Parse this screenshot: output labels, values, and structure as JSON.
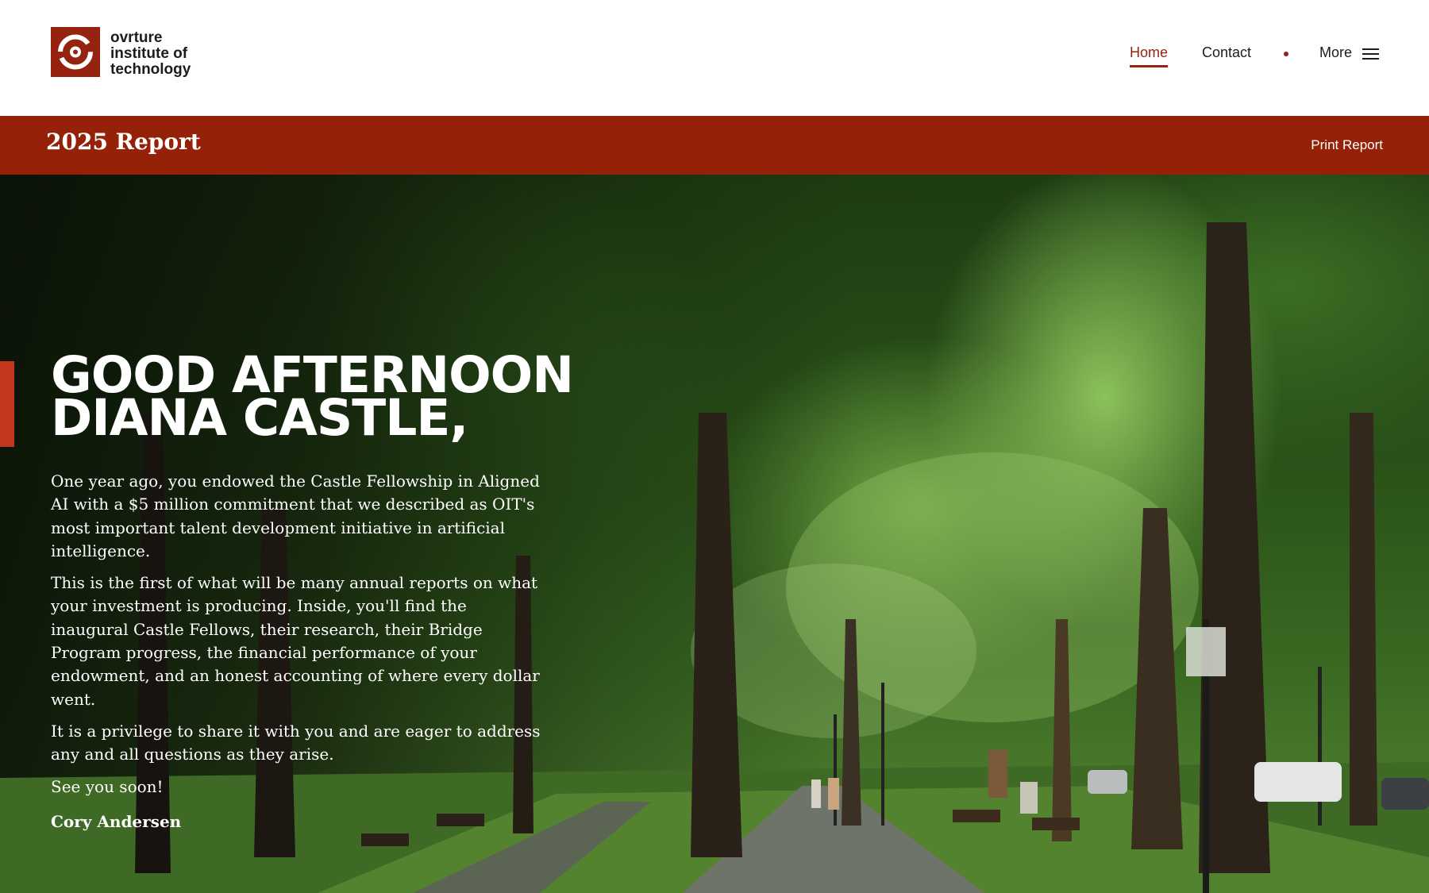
{
  "brand": {
    "name_lines": [
      "ovrture",
      "institute of",
      "technology"
    ],
    "logo_icon": "ovrture-swirl-icon",
    "accent_color": "#962310"
  },
  "nav": {
    "home": "Home",
    "contact": "Contact",
    "more": "More",
    "more_icon": "hamburger-menu-icon",
    "active": "Home"
  },
  "report_bar": {
    "title": "2025 Report",
    "print_label": "Print Report",
    "background": "#952208"
  },
  "hero": {
    "greeting_line1": "GOOD AFTERNOON",
    "greeting_line2": "DIANA CASTLE,",
    "paragraphs": [
      "One year ago, you endowed the Castle Fellowship in Aligned AI with a $5 million commitment that we described as OIT's most important talent development initiative in artificial intelligence.",
      "This is the first of what will be many annual reports on what your investment is producing. Inside, you'll find the inaugural Castle Fellows, their research, their Bridge Program progress, the financial performance of your endowment, and an honest accounting of where every dollar went.",
      "It is a privilege to share it with you and are eager to address any and all questions as they arise.",
      "See you soon!"
    ],
    "signature": "Cory Andersen",
    "background_image": "tree-lined-park-path-photo"
  }
}
